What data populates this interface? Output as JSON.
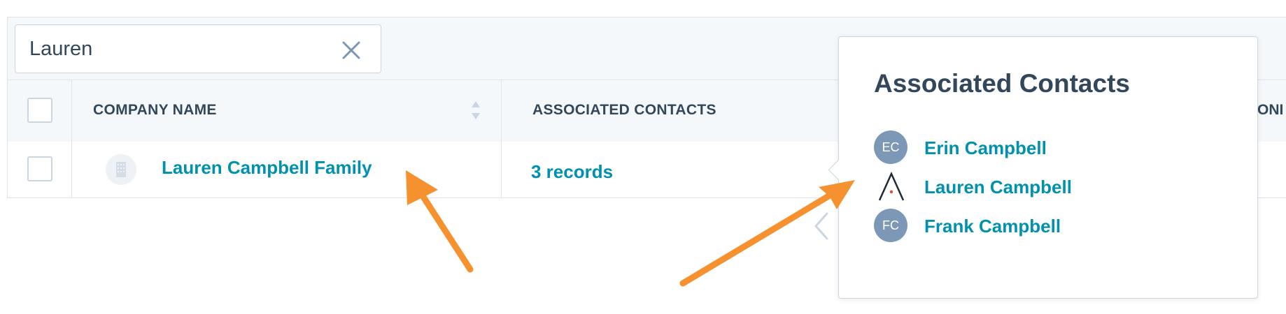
{
  "search": {
    "value": "Lauren"
  },
  "table": {
    "columns": {
      "company_name": "COMPANY NAME",
      "associated_contacts": "ASSOCIATED CONTACTS",
      "cut_off": "ONI"
    },
    "rows": [
      {
        "company_name": "Lauren Campbell Family",
        "associated_contacts": "3 records"
      }
    ]
  },
  "popover": {
    "title": "Associated Contacts",
    "contacts": [
      {
        "initials": "EC",
        "name": "Erin Campbell",
        "avatar": "initials"
      },
      {
        "initials": "",
        "name": "Lauren Campbell",
        "avatar": "brand-logo-icon"
      },
      {
        "initials": "FC",
        "name": "Frank Campbell",
        "avatar": "initials"
      }
    ]
  },
  "colors": {
    "link": "#0091ae",
    "text": "#33475b",
    "annotation_arrow": "#f5922f",
    "avatar": "#7c98b6"
  }
}
